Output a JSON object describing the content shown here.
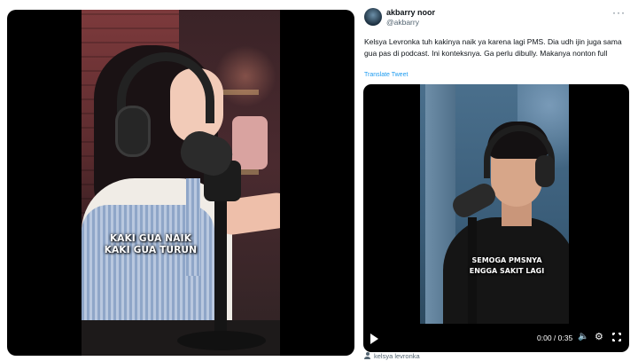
{
  "left_video": {
    "caption_line1": "KAKI GUA NAIK",
    "caption_line2": "KAKI GUA TURUN"
  },
  "tweet": {
    "display_name": "akbarry noor",
    "handle": "@akbarry",
    "more_icon": "more-icon",
    "text": "Kelsya Levronka tuh kakinya naik ya karena lagi PMS. Dia udh ijin juga sama gua pas di podcast. Ini konteksnya. Ga perlu dibully. Makanya nonton full",
    "translate_label": "Translate Tweet",
    "video": {
      "caption_line1": "SEMOGA PMSNYA",
      "caption_line2": "ENGGA SAKIT LAGI",
      "time": "0:00 / 0:35",
      "icons": [
        "play-icon",
        "volume-icon",
        "gear-icon",
        "fullscreen-icon"
      ]
    },
    "tagged_user": "kelsya levronka"
  },
  "colors": {
    "link": "#1d9bf0",
    "secondary_text": "#536471",
    "primary_text": "#0f1419"
  }
}
